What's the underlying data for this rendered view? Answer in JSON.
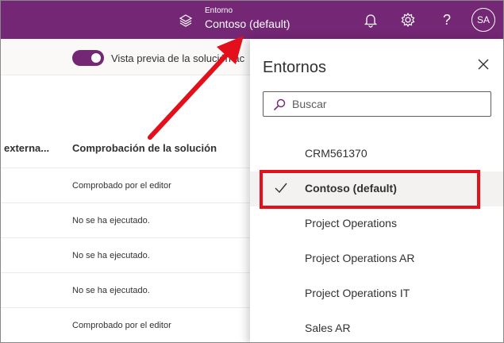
{
  "header": {
    "env_label": "Entorno",
    "env_name": "Contoso (default)",
    "avatar": "SA",
    "help_glyph": "?",
    "icons": [
      "environment-icon",
      "bell-icon",
      "gear-icon",
      "help-icon"
    ],
    "accent_color": "#742774"
  },
  "toolbar": {
    "toggle_label": "Vista previa de la solución ac"
  },
  "table": {
    "columns": [
      "externa...",
      "Comprobación de la solución"
    ],
    "rows": [
      "Comprobado por el editor",
      "No se ha ejecutado.",
      "No se ha ejecutado.",
      "No se ha ejecutado.",
      "Comprobado por el editor"
    ]
  },
  "panel": {
    "title": "Entornos",
    "search_placeholder": "Buscar",
    "environments": [
      {
        "label": "CRM561370",
        "selected": false
      },
      {
        "label": "Contoso (default)",
        "selected": true
      },
      {
        "label": "Project Operations",
        "selected": false
      },
      {
        "label": "Project Operations AR",
        "selected": false
      },
      {
        "label": "Project Operations IT",
        "selected": false
      },
      {
        "label": "Sales AR",
        "selected": false
      }
    ]
  },
  "annotation_color": "#e3101c"
}
